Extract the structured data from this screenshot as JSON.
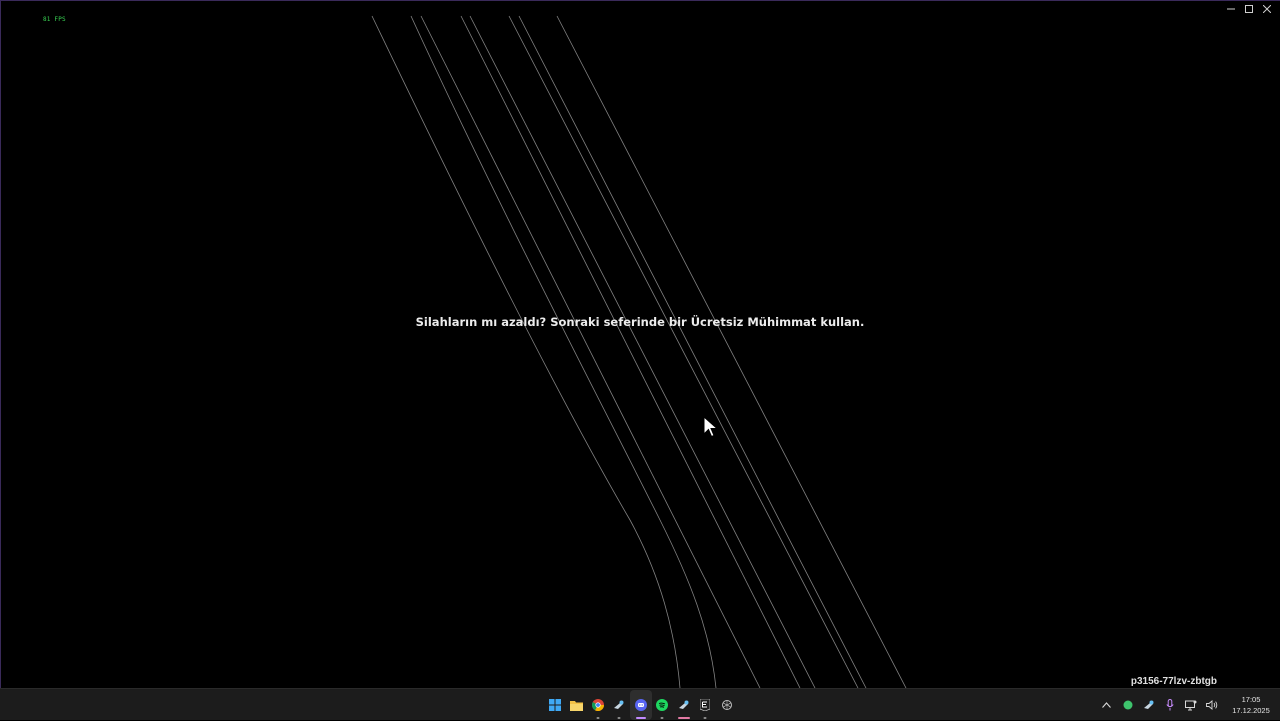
{
  "game": {
    "fps_counter": "81 FPS",
    "loading_tip": "Silahların mı azaldı? Sonraki seferinde bir Ücretsiz Mühimmat kullan.",
    "session_code": "p3156-77lzv-zbtgb"
  },
  "window_controls": [
    "minimize",
    "maximize",
    "close"
  ],
  "taskbar": {
    "apps": [
      {
        "name": "start-button",
        "icon": "windows-logo-icon"
      },
      {
        "name": "file-explorer",
        "icon": "folder-icon"
      },
      {
        "name": "chrome",
        "icon": "chrome-icon"
      },
      {
        "name": "steam",
        "icon": "steam-icon"
      },
      {
        "name": "discord",
        "icon": "discord-icon"
      },
      {
        "name": "spotify",
        "icon": "spotify-icon"
      },
      {
        "name": "steam-game",
        "icon": "steam-icon"
      },
      {
        "name": "epic-games",
        "icon": "epic-games-icon"
      },
      {
        "name": "chatgpt",
        "icon": "openai-icon"
      }
    ],
    "tray": {
      "clock_time": "17:05",
      "clock_date": "17.12.2025"
    }
  },
  "colors": {
    "background": "#000000",
    "fps": "#39d353",
    "taskbar": "#1c1c1c",
    "lines": "#8a8a8a"
  }
}
